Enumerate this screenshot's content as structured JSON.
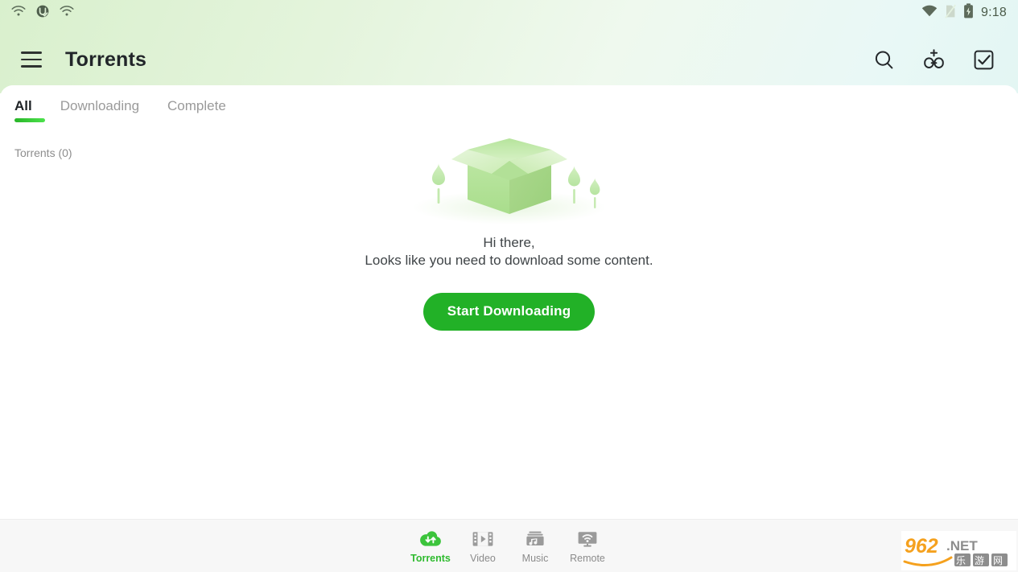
{
  "statusbar": {
    "time": "9:18",
    "left_icons": [
      "wifi-icon",
      "vpn-icon",
      "wifi-icon"
    ],
    "right_icons": [
      "wifi-icon",
      "sim-off-icon",
      "battery-charging-icon"
    ]
  },
  "appbar": {
    "menu_icon": "hamburger-menu-icon",
    "title": "Torrents",
    "actions": [
      {
        "name": "search-icon",
        "label": "Search"
      },
      {
        "name": "add-torrent-icon",
        "label": "Add torrent"
      },
      {
        "name": "select-all-icon",
        "label": "Select"
      }
    ]
  },
  "tabs": [
    {
      "label": "All",
      "active": true
    },
    {
      "label": "Downloading",
      "active": false
    },
    {
      "label": "Complete",
      "active": false
    }
  ],
  "list": {
    "count_label": "Torrents (0)"
  },
  "empty_state": {
    "illustration": "empty-box-illustration",
    "line1": "Hi there,",
    "line2": "Looks like you need to download some content.",
    "cta_label": "Start Downloading"
  },
  "bottom_nav": [
    {
      "label": "Torrents",
      "icon": "cloud-transfer-icon",
      "active": true
    },
    {
      "label": "Video",
      "icon": "film-play-icon",
      "active": false
    },
    {
      "label": "Music",
      "icon": "music-box-icon",
      "active": false
    },
    {
      "label": "Remote",
      "icon": "tv-wifi-icon",
      "active": false
    }
  ],
  "watermark": {
    "primary": "962",
    "suffix": ".NET",
    "sub": "乐游网"
  },
  "colors": {
    "accent_green": "#22b127",
    "tab_active_green": "#3ad63a",
    "nav_active_green": "#2fbb2f",
    "header_gradient_start": "#d9f0cd",
    "header_gradient_end": "#e3f6f3",
    "text_primary": "#22262a",
    "text_muted": "#8d8d8d"
  }
}
